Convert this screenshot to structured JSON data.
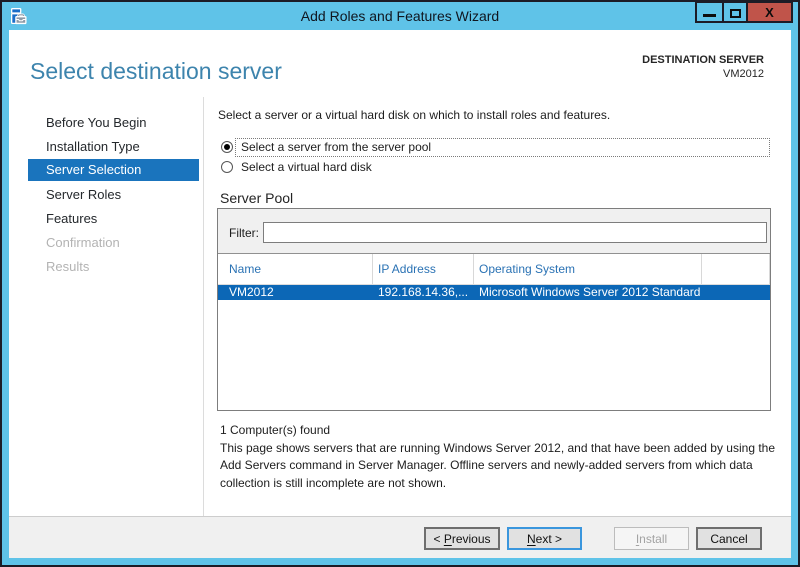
{
  "window": {
    "title": "Add Roles and Features Wizard",
    "controls": {
      "minimize": "minimize",
      "maximize": "maximize",
      "close": "X"
    }
  },
  "header": {
    "title": "Select destination server",
    "context_label": "DESTINATION SERVER",
    "context_value": "VM2012"
  },
  "sidebar": {
    "items": [
      {
        "label": "Before You Begin",
        "state": "normal"
      },
      {
        "label": "Installation Type",
        "state": "normal"
      },
      {
        "label": "Server Selection",
        "state": "selected"
      },
      {
        "label": "Server Roles",
        "state": "normal"
      },
      {
        "label": "Features",
        "state": "normal"
      },
      {
        "label": "Confirmation",
        "state": "disabled"
      },
      {
        "label": "Results",
        "state": "disabled"
      }
    ]
  },
  "main": {
    "intro": "Select a server or a virtual hard disk on which to install roles and features.",
    "radios": [
      {
        "label": "Select a server from the server pool",
        "selected": true
      },
      {
        "label": "Select a virtual hard disk",
        "selected": false
      }
    ],
    "server_pool": {
      "label": "Server Pool",
      "filter_label": "Filter:",
      "filter_value": "",
      "table": {
        "columns": [
          "Name",
          "IP Address",
          "Operating System"
        ],
        "row": {
          "name": "VM2012",
          "ip": "192.168.14.36,...",
          "os": "Microsoft Windows Server 2012 Standard",
          "selected": true
        }
      }
    },
    "count_text": "1 Computer(s) found",
    "description_lines": [
      "This page shows servers that are running Windows Server 2012, and that have been added by using the",
      "Add Servers command in Server Manager. Offline servers and newly-added servers from which data",
      "collection is still incomplete are not shown."
    ]
  },
  "footer": {
    "buttons": [
      {
        "label": "< Previous",
        "accesskey": "P",
        "enabled": true,
        "default": false
      },
      {
        "label": "Next >",
        "accesskey": "N",
        "enabled": true,
        "default": true
      },
      {
        "label": "Install",
        "accesskey": "I",
        "enabled": false,
        "default": false
      },
      {
        "label": "Cancel",
        "accesskey": "",
        "enabled": true,
        "default": false
      }
    ]
  },
  "colors": {
    "frame_blue": "#5fc3e8",
    "frame_dark": "#1c1c26",
    "close_red": "#c0544a",
    "heading_blue": "#3181af",
    "sidebar_selected": "#1a74bd",
    "row_selected": "#0c67b6",
    "footer_gray": "#f0f0f0"
  }
}
